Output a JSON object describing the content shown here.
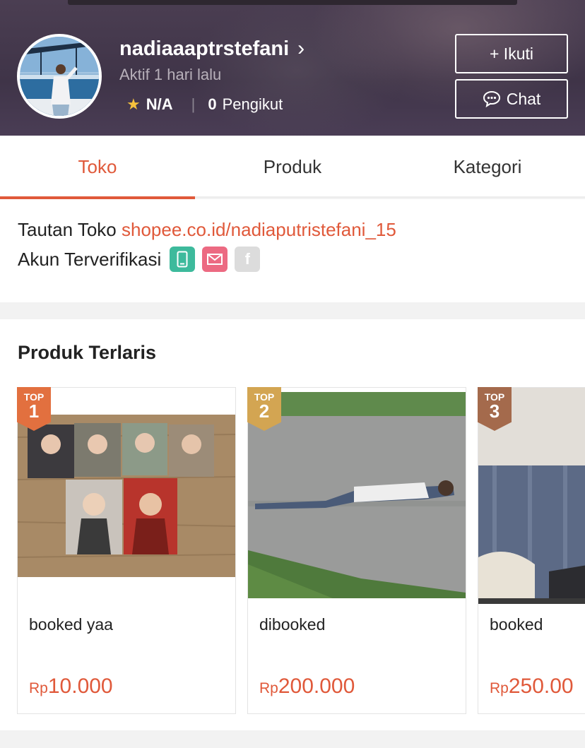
{
  "header": {
    "shop_name": "nadiaaaptrstefani",
    "chevron": "›",
    "active_status": "Aktif 1 hari lalu",
    "rating": "N/A",
    "separator": "|",
    "followers_count": "0",
    "followers_label": "Pengikut",
    "follow_button": "+ Ikuti",
    "chat_button": "Chat"
  },
  "tabs": [
    {
      "label": "Toko",
      "active": true
    },
    {
      "label": "Produk",
      "active": false
    },
    {
      "label": "Kategori",
      "active": false
    }
  ],
  "info": {
    "link_label": "Tautan Toko",
    "link_url": "shopee.co.id/nadiaputristefani_15",
    "verified_label": "Akun Terverifikasi",
    "verified_badges": [
      "phone-icon",
      "mail-icon",
      "facebook-icon"
    ],
    "facebook_letter": "f"
  },
  "bestsellers": {
    "title": "Produk Terlaris",
    "items": [
      {
        "rank_label": "TOP",
        "rank": "1",
        "name": "booked yaa",
        "currency": "Rp",
        "price": "10.000",
        "ribbon_color": "#e2703f"
      },
      {
        "rank_label": "TOP",
        "rank": "2",
        "name": "dibooked",
        "currency": "Rp",
        "price": "200.000",
        "ribbon_color": "#d3a552"
      },
      {
        "rank_label": "TOP",
        "rank": "3",
        "name": "booked",
        "currency": "Rp",
        "price": "250.00",
        "ribbon_color": "#a46a4c"
      }
    ]
  },
  "colors": {
    "accent": "#e0593a",
    "header_bg": "#443949",
    "verify_phone": "#3dba9c",
    "verify_mail": "#ec6a82",
    "verify_facebook": "#dcdcdc"
  }
}
